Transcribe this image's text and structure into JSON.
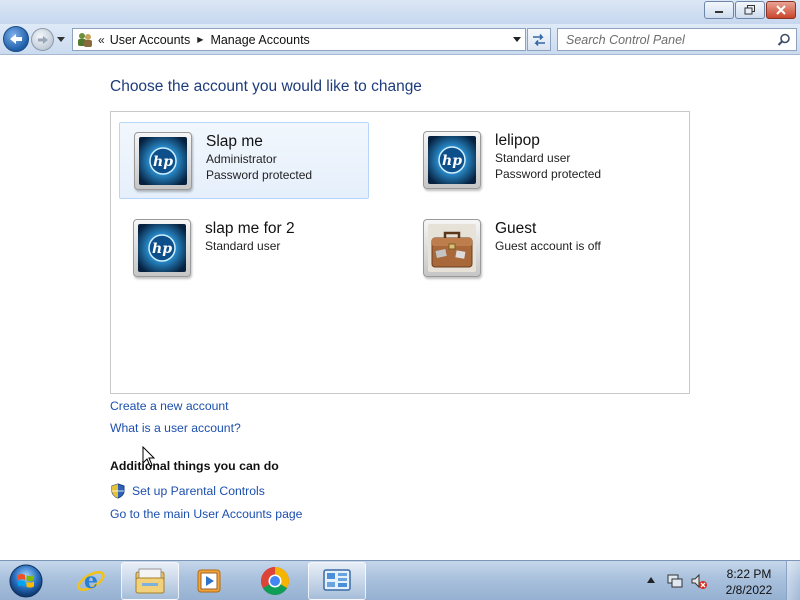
{
  "window": {
    "buttons": {
      "minimize": "minimize-icon",
      "restore": "restore-icon",
      "close": "close-icon"
    }
  },
  "navigation": {
    "overflow_chevron": "«",
    "breadcrumb": [
      "User Accounts",
      "Manage Accounts"
    ],
    "search_placeholder": "Search Control Panel"
  },
  "main": {
    "heading": "Choose the account you would like to change",
    "accounts": [
      {
        "name": "Slap me",
        "lines": [
          "Administrator",
          "Password protected"
        ],
        "picture": "hp-logo",
        "selected": true
      },
      {
        "name": "lelipop",
        "lines": [
          "Standard user",
          "Password protected"
        ],
        "picture": "hp-logo",
        "selected": false
      },
      {
        "name": "slap me for 2",
        "lines": [
          "Standard user"
        ],
        "picture": "hp-logo",
        "selected": false
      },
      {
        "name": "Guest",
        "lines": [
          "Guest account is off"
        ],
        "picture": "briefcase",
        "selected": false
      }
    ],
    "links": {
      "create_account": "Create a new account",
      "what_is_account": "What is a user account?"
    },
    "additional": {
      "title": "Additional things you can do",
      "parental_controls": "Set up Parental Controls",
      "main_page": "Go to the main User Accounts page"
    }
  },
  "taskbar": {
    "items": [
      "start-orb",
      "internet-explorer",
      "windows-explorer",
      "media-player",
      "chrome",
      "control-panel"
    ],
    "active": "control-panel",
    "clock": {
      "time": "8:22 PM",
      "date": "2/8/2022"
    }
  },
  "colors": {
    "heading": "#1e3c7c",
    "link": "#1c4fae",
    "selection_bg": "#e5effb",
    "selection_border": "#b8d6fb"
  }
}
